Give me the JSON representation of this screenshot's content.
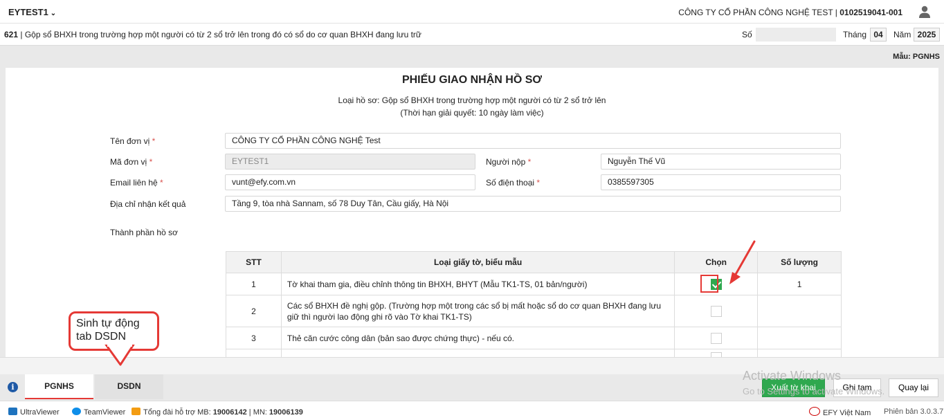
{
  "header": {
    "tenant": "EYTEST1",
    "company_name": "CÔNG TY CỔ PHẦN CÔNG NGHỆ TEST",
    "tax_code": "0102519041-001"
  },
  "subheader": {
    "code": "621",
    "title": "Gộp sổ BHXH trong trường hợp một người có từ 2 sổ trở lên trong đó có sổ do cơ quan BHXH đang lưu trữ",
    "so_label": "Số",
    "so_value": "",
    "thang_label": "Tháng",
    "thang_value": "04",
    "nam_label": "Năm",
    "nam_value": "2025"
  },
  "template_label": "Mẫu: PGNHS",
  "form": {
    "title": "PHIẾU GIAO NHẬN HỒ SƠ",
    "loai_ho_so": "Loại hồ sơ: Gộp sổ BHXH trong trường hợp một người có từ 2 sổ trở lên",
    "thoi_han": "(Thời hạn giải quyết: 10 ngày làm việc)",
    "fields": {
      "ten_don_vi_label": "Tên đơn vị",
      "ten_don_vi_value": "CÔNG TY CỔ PHẦN CÔNG NGHỆ Test",
      "ma_don_vi_label": "Mã đơn vị",
      "ma_don_vi_value": "EYTEST1",
      "nguoi_nop_label": "Người nộp",
      "nguoi_nop_value": "Nguyễn Thế Vũ",
      "email_label": "Email liên hệ",
      "email_value": "vunt@efy.com.vn",
      "sdt_label": "Số điện thoại",
      "sdt_value": "0385597305",
      "dia_chi_label": "Địa chỉ nhận kết quả",
      "dia_chi_value": "Tầng 9, tòa nhà Sannam, số 78 Duy Tân, Cầu giấy, Hà Nội"
    },
    "required_mark": "*",
    "thanh_phan_label": "Thành phần hồ sơ",
    "table": {
      "headers": [
        "STT",
        "Loại giấy tờ, biểu mẫu",
        "Chọn",
        "Số lượng"
      ],
      "rows": [
        {
          "stt": "1",
          "desc": "Tờ khai tham gia, điều chỉnh thông tin BHXH, BHYT (Mẫu TK1-TS, 01 bản/người)",
          "checked": true,
          "qty": "1"
        },
        {
          "stt": "2",
          "desc": "Các sổ BHXH đề nghị gộp. (Trường hợp một trong các sổ bị mất hoặc sổ do cơ quan BHXH đang lưu giữ thì người lao động ghi rõ vào Tờ khai TK1-TS)",
          "checked": false,
          "qty": ""
        },
        {
          "stt": "3",
          "desc": "Thẻ căn cước công dân (bản sao được chứng thực) - nếu có.",
          "checked": false,
          "qty": ""
        }
      ]
    }
  },
  "callout_text": "Sinh tự động tab DSDN",
  "tabs": [
    {
      "label": "PGNHS",
      "active": true
    },
    {
      "label": "DSDN",
      "active": false
    }
  ],
  "actions": {
    "export": "Xuất tờ khai",
    "save_draft": "Ghi tạm",
    "back": "Quay lại"
  },
  "watermark": {
    "line1": "Activate Windows",
    "line2": "Go to Settings to activate Windows."
  },
  "footer": {
    "ultraviewer": "UltraViewer",
    "teamviewer": "TeamViewer",
    "hotline_prefix": "Tổng đài hỗ trợ MB:",
    "hotline_mb": "19006142",
    "hotline_sep": "| MN:",
    "hotline_mn": "19006139",
    "brand": "EFY Việt Nam",
    "version": "Phiên bản 3.0.3.7"
  },
  "colors": {
    "accent_red": "#e53935",
    "primary_green": "#2fa84f"
  }
}
